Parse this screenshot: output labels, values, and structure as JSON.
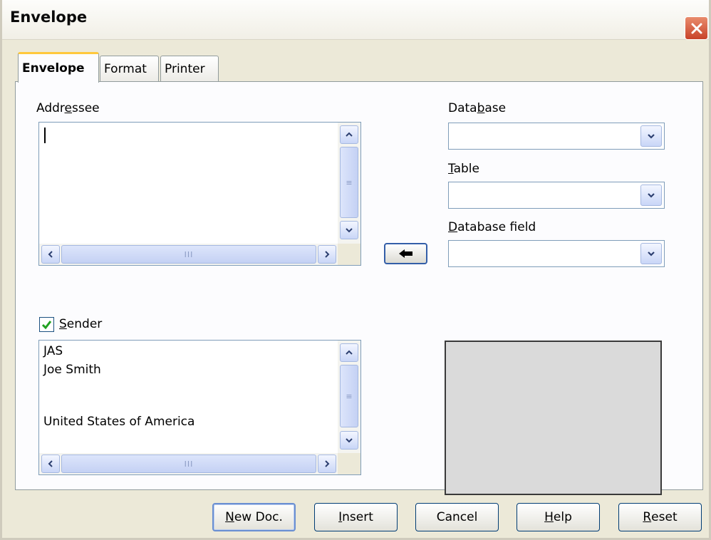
{
  "window": {
    "title": "Envelope"
  },
  "tabs": [
    {
      "label": "Envelope",
      "active": true
    },
    {
      "label": "Format",
      "active": false
    },
    {
      "label": "Printer",
      "active": false
    }
  ],
  "addressee": {
    "label_pre": "Addr",
    "label_ul": "e",
    "label_post": "ssee",
    "value": ""
  },
  "database": {
    "label_pre": "Data",
    "label_ul": "b",
    "label_post": "ase",
    "value": ""
  },
  "table": {
    "label_pre": "",
    "label_ul": "T",
    "label_post": "able",
    "value": ""
  },
  "database_field": {
    "label_pre": "",
    "label_ul": "D",
    "label_post": "atabase field",
    "value": ""
  },
  "sender": {
    "label_pre": "",
    "label_ul": "S",
    "label_post": "ender",
    "checked": true,
    "lines": [
      "JAS",
      "Joe Smith",
      "",
      "",
      "United States of America"
    ]
  },
  "buttons": {
    "new_doc": {
      "ul": "N",
      "rest": "ew Doc."
    },
    "insert": {
      "ul": "I",
      "rest": "nsert"
    },
    "cancel": {
      "label": "Cancel"
    },
    "help": {
      "ul": "H",
      "rest": "elp"
    },
    "reset": {
      "ul": "R",
      "rest": "eset"
    }
  },
  "icons": {
    "close": "close-icon",
    "insert_arrow": "arrow-left-icon",
    "dropdown": "chevron-down-icon"
  },
  "colors": {
    "close_button": "#c8432a",
    "checkmark": "#21a121",
    "active_tab_accent": "#ffc83c",
    "preview_bg": "#dadada"
  }
}
